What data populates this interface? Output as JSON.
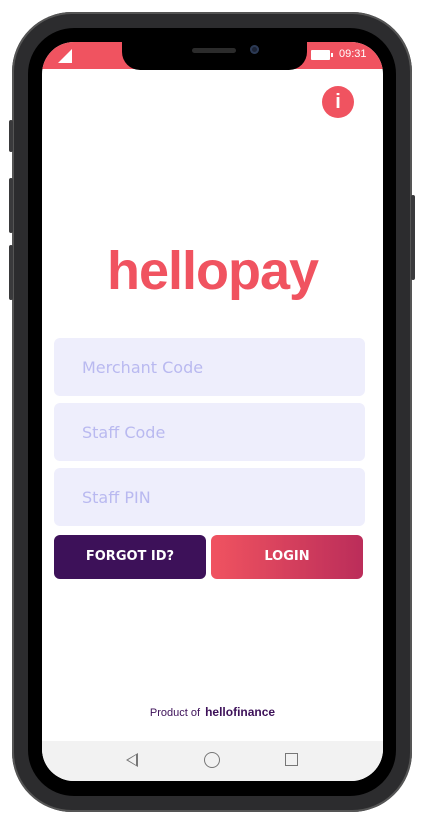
{
  "status_bar": {
    "time": "09:31",
    "signal_icon": "signal-icon",
    "battery_icon": "battery-icon"
  },
  "header": {
    "info_label": "i"
  },
  "logo": {
    "text": "hellopay"
  },
  "login_form": {
    "merchant_code": {
      "placeholder": "Merchant Code",
      "value": ""
    },
    "staff_code": {
      "placeholder": "Staff Code",
      "value": ""
    },
    "staff_pin": {
      "placeholder": "Staff PIN",
      "value": ""
    },
    "forgot_label": "FORGOT ID?",
    "login_label": "LOGIN"
  },
  "footer": {
    "product_of": "Product of",
    "brand": "hellofinance"
  },
  "nav_bar": {
    "icons": [
      "back-icon",
      "home-icon",
      "recent-apps-icon"
    ]
  },
  "colors": {
    "accent": "#f05360",
    "dark": "#3d1159",
    "field_bg": "#eeeefc",
    "placeholder": "#b9b9f0"
  }
}
